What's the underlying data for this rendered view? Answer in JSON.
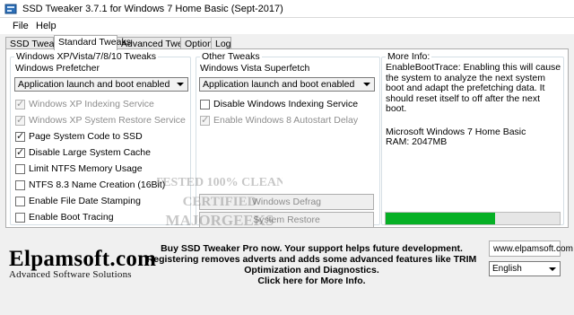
{
  "window": {
    "title": "SSD Tweaker 3.7.1 for Windows 7 Home Basic  (Sept-2017)"
  },
  "menu": {
    "file": "File",
    "help": "Help"
  },
  "tabs": [
    {
      "label": "SSD Tweaker",
      "active": false
    },
    {
      "label": "Standard Tweaks",
      "active": true
    },
    {
      "label": "Advanced Tweaks",
      "active": false
    },
    {
      "label": "Options",
      "active": false
    },
    {
      "label": "Log",
      "active": false
    }
  ],
  "left_group": {
    "title": "Windows XP/Vista/7/8/10 Tweaks",
    "subtitle": "Windows Prefetcher",
    "select_value": "Application launch and boot enabled",
    "checkboxes": [
      {
        "label": "Windows XP Indexing Service",
        "checked": true,
        "enabled": false
      },
      {
        "label": "Windows XP System Restore Service",
        "checked": true,
        "enabled": false
      },
      {
        "label": "Page System Code to SSD",
        "checked": true,
        "enabled": true
      },
      {
        "label": "Disable Large System Cache",
        "checked": true,
        "enabled": true
      },
      {
        "label": "Limit NTFS Memory Usage",
        "checked": false,
        "enabled": true
      },
      {
        "label": "NTFS 8.3 Name Creation (16Bit)",
        "checked": false,
        "enabled": true
      },
      {
        "label": "Enable File Date Stamping",
        "checked": false,
        "enabled": true
      },
      {
        "label": "Enable Boot Tracing",
        "checked": false,
        "enabled": true
      }
    ]
  },
  "mid_group": {
    "title": "Other Tweaks",
    "subtitle": "Windows Vista Superfetch",
    "select_value": "Application launch and boot enabled",
    "checkboxes": [
      {
        "label": "Disable Windows Indexing Service",
        "checked": false,
        "enabled": true
      },
      {
        "label": "Enable Windows 8 Autostart Delay",
        "checked": true,
        "enabled": false
      }
    ],
    "buttons": {
      "defrag": "Windows Defrag",
      "restore": "System Restore"
    }
  },
  "info": {
    "title": "More Info:",
    "description": "EnableBootTrace: Enabling this will cause the system to analyze the next system boot and adapt the prefetching data. It should reset itself to off after the next boot.",
    "os": "Microsoft Windows 7 Home Basic",
    "ram": "RAM: 2047MB",
    "progress": 0.63
  },
  "footer": {
    "brand": "Elpamsoft.com",
    "tagline": "Advanced Software Solutions",
    "promo_1": "Buy SSD Tweaker Pro now. Your support helps future development.",
    "promo_2": "Registering removes adverts and adds some advanced features like TRIM Optimization and Diagnostics.",
    "promo_3": "Click here for More Info.",
    "url": "www.elpamsoft.com",
    "language": "English"
  },
  "watermark": {
    "line1": "TESTED 100% CLEAN",
    "line2": "CERTIFIED",
    "line3": "MAJORGEEKS"
  },
  "colors": {
    "progress_fill": "#06b025",
    "group_border": "#d5dfe5"
  }
}
